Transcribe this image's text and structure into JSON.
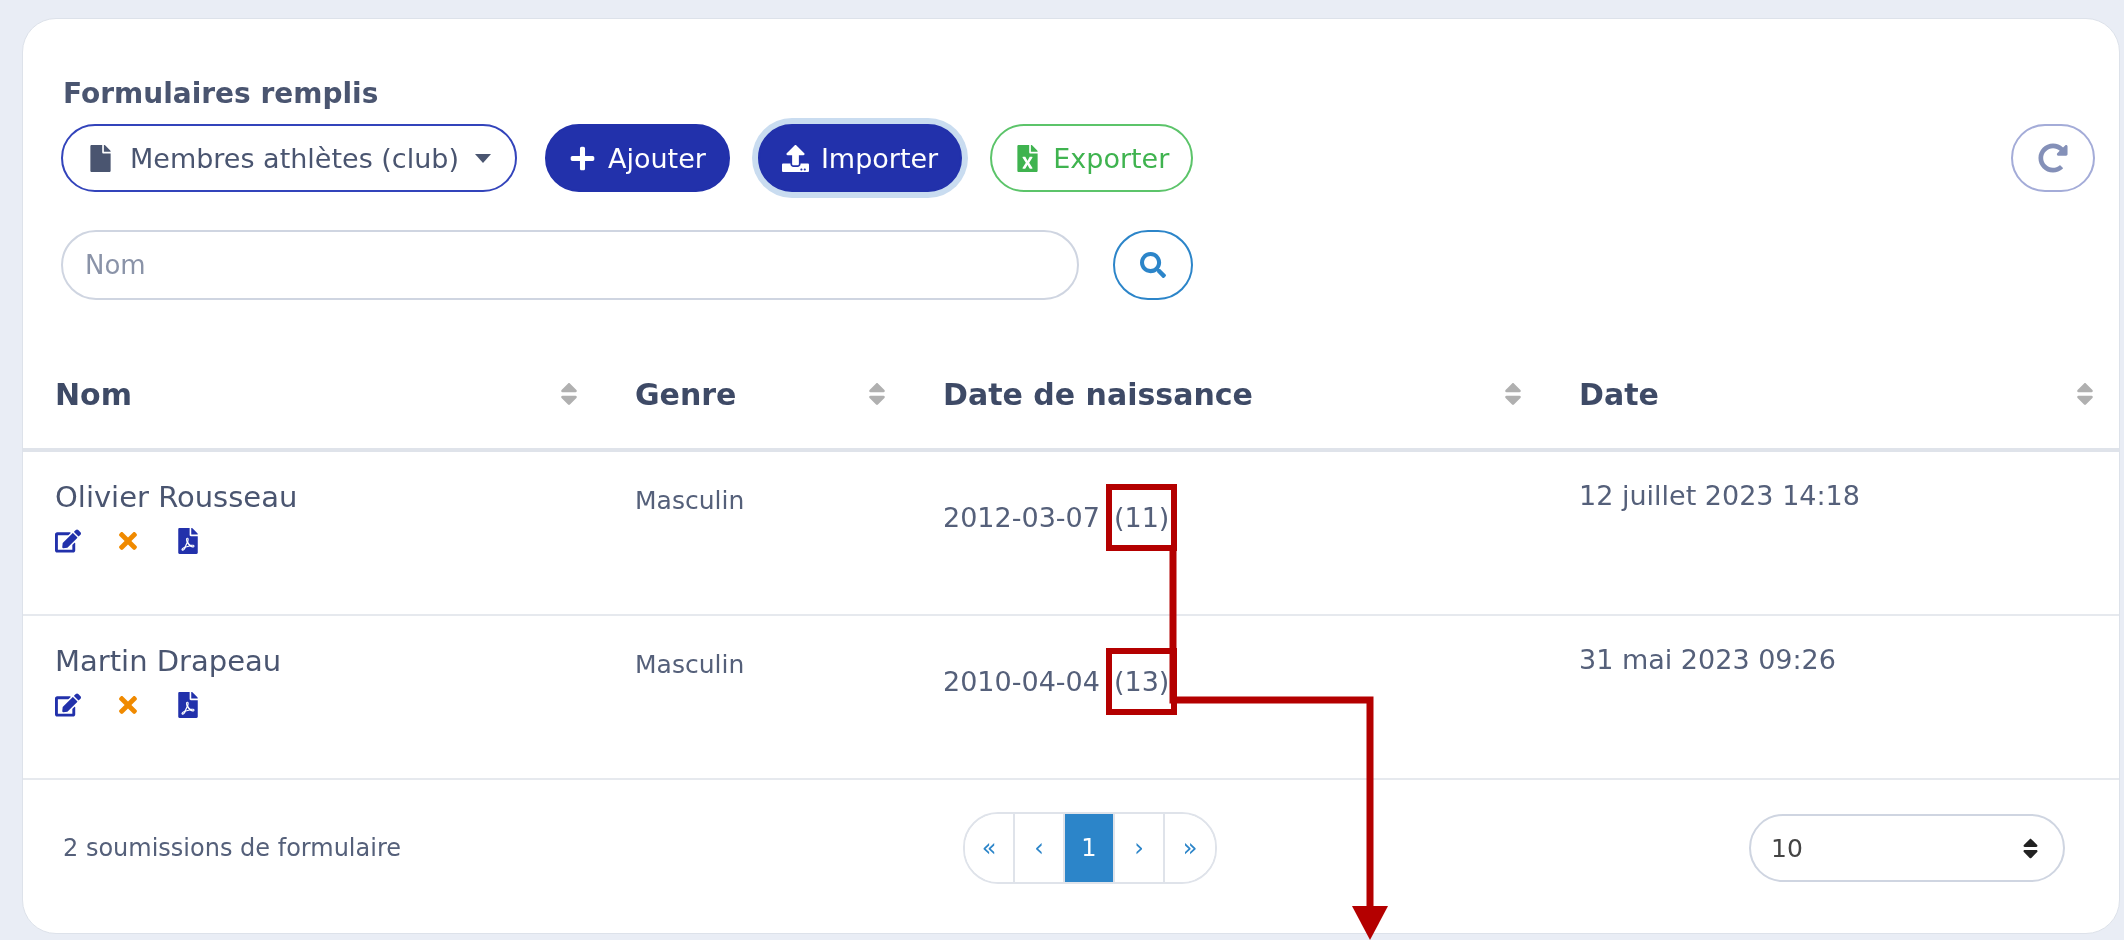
{
  "section_title": "Formulaires remplis",
  "toolbar": {
    "form_select": {
      "value": "Membres athlètes (club)"
    },
    "buttons": [
      {
        "label": "Ajouter",
        "kind": "add",
        "focused": false
      },
      {
        "label": "Importer",
        "kind": "import",
        "focused": true
      },
      {
        "label": "Exporter",
        "kind": "export",
        "focused": false
      }
    ]
  },
  "search": {
    "placeholder": "Nom"
  },
  "table": {
    "columns": [
      "Nom",
      "Genre",
      "Date de naissance",
      "Date"
    ],
    "rows": [
      {
        "name": "Olivier Rousseau",
        "genre": "Masculin",
        "birth_date": "2012-03-07",
        "age": "(11)",
        "age_highlighted": true,
        "date": "12 juillet 2023 14:18"
      },
      {
        "name": "Martin Drapeau",
        "genre": "Masculin",
        "birth_date": "2010-04-04",
        "age": "(13)",
        "age_highlighted": true,
        "date": "31 mai 2023 09:26"
      }
    ]
  },
  "footer": {
    "count": "2 soumissions de formulaire",
    "pagination": {
      "first": "«",
      "prev": "‹",
      "pages": [
        {
          "label": "1",
          "selected": true
        }
      ],
      "next": "›",
      "last": "»"
    },
    "page_size": "10"
  }
}
